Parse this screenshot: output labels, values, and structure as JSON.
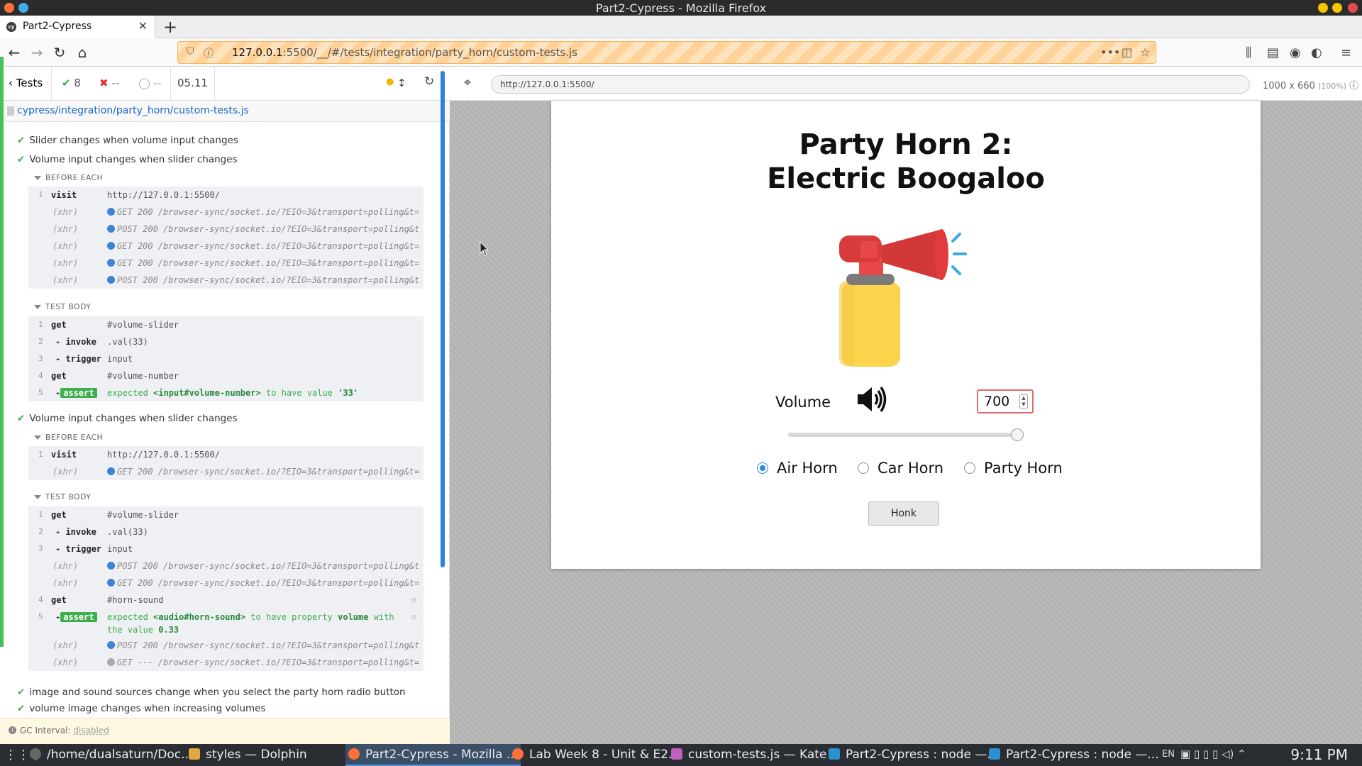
{
  "window": {
    "title": "Part2-Cypress - Mozilla Firefox"
  },
  "browser": {
    "tab_label": "Part2-Cypress",
    "url_host": "127.0.0.1",
    "url_rest": ":5500/__/#/tests/integration/party_horn/custom-tests.js"
  },
  "reporter": {
    "tests_label": "Tests",
    "passed": "8",
    "failed": "--",
    "pending": "--",
    "duration": "05.11",
    "spec_path": "cypress/integration/party_horn/custom-tests.js",
    "gc_label": "GC Interval:",
    "gc_value": "disabled",
    "tests": [
      "Slider changes when volume input changes",
      "Volume input changes when slider changes",
      "Volume input changes when slider changes",
      "image and sound sources change when you select the party horn radio button",
      "volume image changes when increasing volumes"
    ],
    "hooks": {
      "before_each": "BEFORE EACH",
      "test_body": "TEST BODY"
    },
    "block1_before": [
      {
        "n": "1",
        "name": "visit",
        "msg": "http://127.0.0.1:5500/"
      },
      {
        "n": "",
        "name": "(xhr)",
        "msg": "GET 200 /browser-sync/socket.io/?EIO=3&transport=polling&t=…"
      },
      {
        "n": "",
        "name": "(xhr)",
        "msg": "POST 200 /browser-sync/socket.io/?EIO=3&transport=polling&t…"
      },
      {
        "n": "",
        "name": "(xhr)",
        "msg": "GET 200 /browser-sync/socket.io/?EIO=3&transport=polling&t=…"
      },
      {
        "n": "",
        "name": "(xhr)",
        "msg": "GET 200 /browser-sync/socket.io/?EIO=3&transport=polling&t=…"
      },
      {
        "n": "",
        "name": "(xhr)",
        "msg": "POST 200 /browser-sync/socket.io/?EIO=3&transport=polling&t…"
      }
    ],
    "block1_body": [
      {
        "n": "1",
        "name": "get",
        "msg": "#volume-slider"
      },
      {
        "n": "2",
        "name": "-invoke",
        "msg": ".val(33)"
      },
      {
        "n": "3",
        "name": "-trigger",
        "msg": "input"
      },
      {
        "n": "4",
        "name": "get",
        "msg": "#volume-number"
      }
    ],
    "block1_assert": {
      "n": "5",
      "badge": "assert",
      "pre": "expected ",
      "el": "<input#volume-number>",
      "mid": " to have value ",
      "val": "'33'"
    },
    "block2_before": [
      {
        "n": "1",
        "name": "visit",
        "msg": "http://127.0.0.1:5500/"
      },
      {
        "n": "",
        "name": "(xhr)",
        "msg": "GET 200 /browser-sync/socket.io/?EIO=3&transport=polling&t=…"
      }
    ],
    "block2_body": [
      {
        "n": "1",
        "name": "get",
        "msg": "#volume-slider"
      },
      {
        "n": "2",
        "name": "-invoke",
        "msg": ".val(33)"
      },
      {
        "n": "3",
        "name": "-trigger",
        "msg": "input"
      },
      {
        "n": "",
        "name": "(xhr)",
        "msg": "POST 200 /browser-sync/socket.io/?EIO=3&transport=polling&t…"
      },
      {
        "n": "",
        "name": "(xhr)",
        "msg": "GET 200 /browser-sync/socket.io/?EIO=3&transport=polling&t=…"
      },
      {
        "n": "4",
        "name": "get",
        "msg": "#horn-sound"
      }
    ],
    "block2_assert": {
      "n": "5",
      "badge": "assert",
      "pre": "expected ",
      "el": "<audio#horn-sound>",
      "mid": " to have property ",
      "prop": "volume",
      "with": " with",
      "line2": "the value ",
      "val": "0.33"
    },
    "block2_after": [
      {
        "n": "",
        "name": "(xhr)",
        "msg": "POST 200 /browser-sync/socket.io/?EIO=3&transport=polling&t…"
      },
      {
        "n": "",
        "name": "(xhr)",
        "msg": "GET --- /browser-sync/socket.io/?EIO=3&transport=polling&t=…"
      }
    ]
  },
  "aut": {
    "url": "http://127.0.0.1:5500/",
    "size": "1000 x 660",
    "scale": "(100%)"
  },
  "app": {
    "title_line1": "Party Horn 2:",
    "title_line2": "Electric Boogaloo",
    "volume_label": "Volume",
    "volume_value": "700",
    "slider_fraction": 1.0,
    "radios": [
      {
        "label": "Air Horn",
        "checked": true
      },
      {
        "label": "Car Horn",
        "checked": false
      },
      {
        "label": "Party Horn",
        "checked": false
      }
    ],
    "honk_label": "Honk"
  },
  "taskbar": {
    "items": [
      "/home/dualsaturn/Doc...",
      "styles — Dolphin",
      "Part2-Cypress - Mozilla ...",
      "Lab Week 8 - Unit & E2...",
      "custom-tests.js — Kate",
      "Part2-Cypress : node —...",
      "Part2-Cypress : node —..."
    ],
    "lang": "EN",
    "clock": "9:11 PM"
  },
  "colors": {
    "pass": "#3fae4f",
    "accent": "#2b86e3",
    "url_warning": "#ffd29a"
  }
}
